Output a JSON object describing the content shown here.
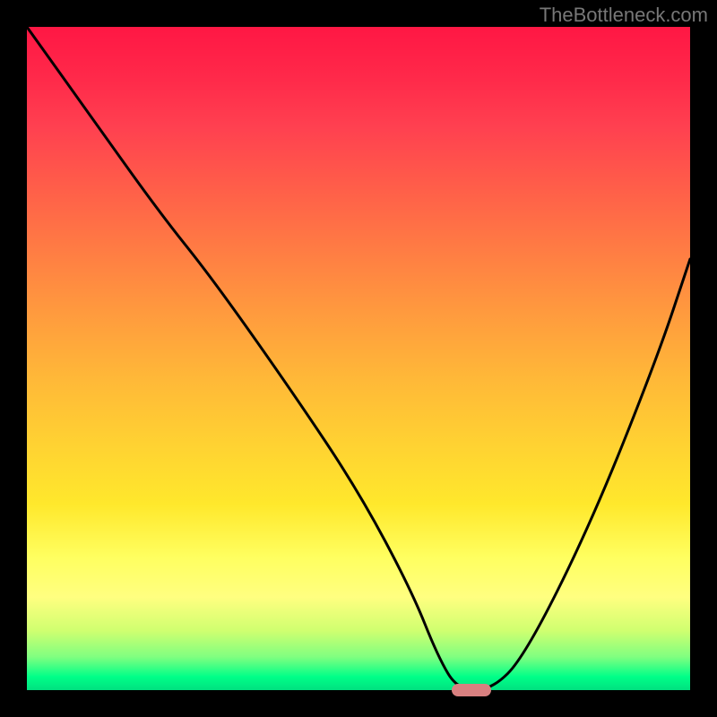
{
  "watermark": "TheBottleneck.com",
  "chart_data": {
    "type": "line",
    "title": "",
    "xlabel": "",
    "ylabel": "",
    "xlim": [
      0,
      100
    ],
    "ylim": [
      0,
      100
    ],
    "x": [
      0,
      10,
      20,
      28,
      40,
      50,
      58,
      62,
      65,
      70,
      75,
      85,
      95,
      100
    ],
    "values": [
      100,
      86,
      72,
      62,
      45,
      30,
      15,
      5,
      0,
      0,
      5,
      25,
      50,
      65
    ],
    "marker": {
      "x": 67,
      "y": 0,
      "w": 6,
      "h": 2
    },
    "gradient_stops": [
      {
        "pos": 0,
        "color": "#ff1744"
      },
      {
        "pos": 50,
        "color": "#ffc838"
      },
      {
        "pos": 80,
        "color": "#ffff60"
      },
      {
        "pos": 100,
        "color": "#00e080"
      }
    ]
  }
}
